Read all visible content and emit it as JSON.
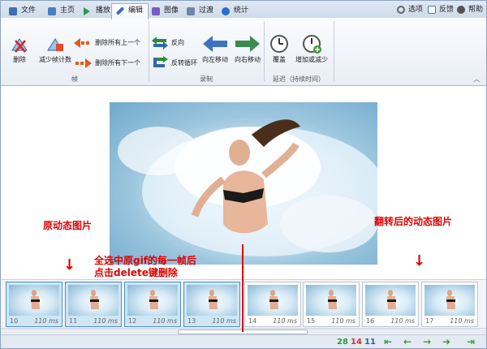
{
  "tabs": [
    {
      "label": "文件",
      "color": "#3f6fb5"
    },
    {
      "label": "主页",
      "color": "#4a7fc4"
    },
    {
      "label": "播放",
      "color": "#2e9a4a"
    },
    {
      "label": "编辑",
      "color": "#3a6fc0",
      "active": true
    },
    {
      "label": "图像",
      "color": "#7a5cc0"
    },
    {
      "label": "过渡",
      "color": "#6f86a6"
    },
    {
      "label": "统计",
      "color": "#2a6fd0"
    }
  ],
  "topright": {
    "options": "选项",
    "feedback": "反馈",
    "help": "帮助"
  },
  "ribbon": {
    "frames_group": {
      "delete": "删除",
      "reduce": "减少帧计数",
      "delete_all_prev": "删除所有上一个",
      "delete_all_next": "删除所有下一个",
      "label": "帧"
    },
    "record_group": {
      "reverse": "反向",
      "yoyo": "反转循环",
      "move_left": "向左移动",
      "move_right": "向右移动",
      "label": "录制"
    },
    "delay_group": {
      "override": "覆盖",
      "inc_dec": "增加或减少",
      "label": "延迟（持续时间）"
    }
  },
  "annotations": {
    "original": "原动态图片",
    "reversed": "翻转后的动态图片",
    "select_line1": "全选中原gif的每一帧后",
    "select_line2": "点击delete键删除",
    "arrow": "↓"
  },
  "frames": [
    {
      "num": "10",
      "dur": "110 ms",
      "selected": true
    },
    {
      "num": "11",
      "dur": "110 ms",
      "selected": true
    },
    {
      "num": "12",
      "dur": "110 ms",
      "selected": true
    },
    {
      "num": "13",
      "dur": "110 ms",
      "selected": true
    },
    {
      "num": "14",
      "dur": "110 ms",
      "selected": false
    },
    {
      "num": "15",
      "dur": "110 ms",
      "selected": false
    },
    {
      "num": "16",
      "dur": "110 ms",
      "selected": false
    },
    {
      "num": "17",
      "dur": "110 ms",
      "selected": false
    }
  ],
  "status": {
    "total": "28",
    "selected": "14",
    "current": "11"
  },
  "colors": {
    "accent": "#4b8fcf",
    "annotation": "#e00000",
    "nav": "#3a9a3a"
  }
}
